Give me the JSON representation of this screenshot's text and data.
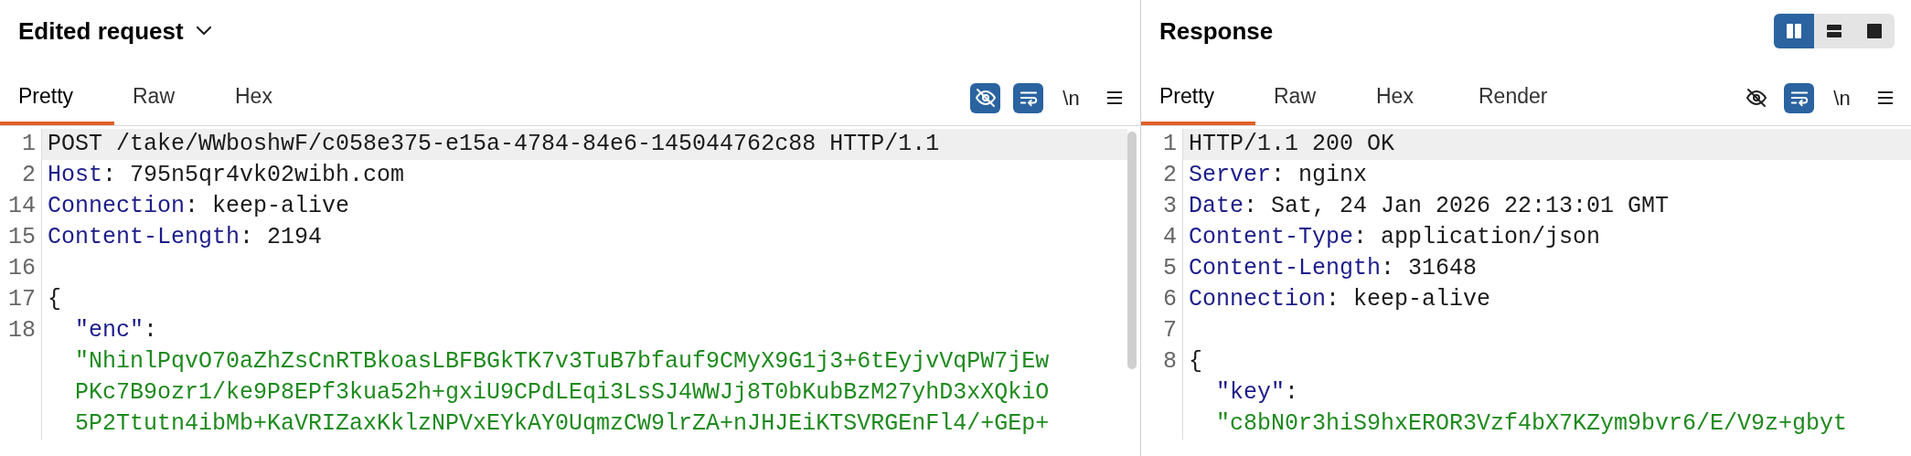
{
  "panels": [
    {
      "title": "Edited request",
      "has_dropdown": true,
      "tabs": [
        {
          "label": "Pretty",
          "selected": true
        },
        {
          "label": "Raw",
          "selected": false
        },
        {
          "label": "Hex",
          "selected": false
        }
      ],
      "toolbar": [
        {
          "kind": "eye-off",
          "selected": true
        },
        {
          "kind": "wrap",
          "selected": true
        },
        {
          "kind": "text",
          "label": "\\n",
          "selected": false
        },
        {
          "kind": "menu"
        }
      ],
      "lines": [
        {
          "number": "1",
          "selected": true,
          "segments": [
            {
              "kind": "plain",
              "text": "POST /take/WWboshwF/c058e375-e15a-4784-84e6-145044762c88 HTTP/1.1"
            }
          ]
        },
        {
          "number": "2",
          "selected": false,
          "segments": [
            {
              "kind": "name",
              "text": "Host"
            },
            {
              "kind": "plain",
              "text": ": 795n5qr4vk02wibh.com"
            }
          ]
        },
        {
          "number": "14",
          "selected": false,
          "segments": [
            {
              "kind": "name",
              "text": "Connection"
            },
            {
              "kind": "plain",
              "text": ": keep-alive"
            }
          ]
        },
        {
          "number": "15",
          "selected": false,
          "segments": [
            {
              "kind": "name",
              "text": "Content-Length"
            },
            {
              "kind": "plain",
              "text": ": 2194"
            }
          ]
        },
        {
          "number": "16",
          "selected": false
        },
        {
          "number": "17",
          "selected": false,
          "segments": [
            {
              "kind": "plain",
              "text": "{"
            }
          ]
        },
        {
          "number": "18",
          "selected": false,
          "segments": [
            {
              "kind": "name",
              "text": "  \"enc\""
            },
            {
              "kind": "plain",
              "text": ":"
            }
          ]
        },
        {
          "selected": false,
          "segments": [
            {
              "kind": "string",
              "text": "  \"NhinlPqvO70aZhZsCnRTBkoasLBFBGkTK7v3TuB7bfauf9CMyX9G1j3+6tEyjvVqPW7jEw"
            }
          ]
        },
        {
          "selected": false,
          "segments": [
            {
              "kind": "string",
              "text": "  PKc7B9ozr1/ke9P8EPf3kua52h+gxiU9CPdLEqi3LsSJ4WWJj8T0bKubBzM27yhD3xXQkiO"
            }
          ]
        },
        {
          "selected": false,
          "segments": [
            {
              "kind": "string",
              "text": "  5P2Ttutn4ibMb+KaVRIZaxKklzNPVxEYkAY0UqmzCW9lrZA+nJHJEiKTSVRGEnFl4/+GEp+"
            }
          ]
        }
      ]
    },
    {
      "title": "Response",
      "has_dropdown": false,
      "layout_buttons": [
        {
          "kind": "columns",
          "selected": true
        },
        {
          "kind": "rows",
          "selected": false
        },
        {
          "kind": "single",
          "selected": false
        }
      ],
      "tabs": [
        {
          "label": "Pretty",
          "selected": true
        },
        {
          "label": "Raw",
          "selected": false
        },
        {
          "label": "Hex",
          "selected": false
        },
        {
          "label": "Render",
          "selected": false
        }
      ],
      "toolbar": [
        {
          "kind": "eye-off",
          "selected": false
        },
        {
          "kind": "wrap",
          "selected": true
        },
        {
          "kind": "text",
          "label": "\\n",
          "selected": false
        },
        {
          "kind": "menu"
        }
      ],
      "lines": [
        {
          "number": "1",
          "selected": true,
          "segments": [
            {
              "kind": "plain",
              "text": "HTTP/1.1 200 OK"
            }
          ]
        },
        {
          "number": "2",
          "selected": false,
          "segments": [
            {
              "kind": "name",
              "text": "Server"
            },
            {
              "kind": "plain",
              "text": ": nginx"
            }
          ]
        },
        {
          "number": "3",
          "selected": false,
          "segments": [
            {
              "kind": "name",
              "text": "Date"
            },
            {
              "kind": "plain",
              "text": ": Sat, 24 Jan 2026 22:13:01 GMT"
            }
          ]
        },
        {
          "number": "4",
          "selected": false,
          "segments": [
            {
              "kind": "name",
              "text": "Content-Type"
            },
            {
              "kind": "plain",
              "text": ": application/json"
            }
          ]
        },
        {
          "number": "5",
          "selected": false,
          "segments": [
            {
              "kind": "name",
              "text": "Content-Length"
            },
            {
              "kind": "plain",
              "text": ": 31648"
            }
          ]
        },
        {
          "number": "6",
          "selected": false,
          "segments": [
            {
              "kind": "name",
              "text": "Connection"
            },
            {
              "kind": "plain",
              "text": ": keep-alive"
            }
          ]
        },
        {
          "number": "7",
          "selected": false
        },
        {
          "number": "8",
          "selected": false,
          "segments": [
            {
              "kind": "plain",
              "text": "{"
            }
          ]
        },
        {
          "selected": false,
          "segments": [
            {
              "kind": "name",
              "text": "  \"key\""
            },
            {
              "kind": "plain",
              "text": ":"
            }
          ]
        },
        {
          "selected": false,
          "segments": [
            {
              "kind": "string",
              "text": "  \"c8bN0r3hiS9hxEROR3Vzf4bX7KZym9bvr6/E/V9z+gbyt"
            }
          ]
        }
      ]
    }
  ]
}
